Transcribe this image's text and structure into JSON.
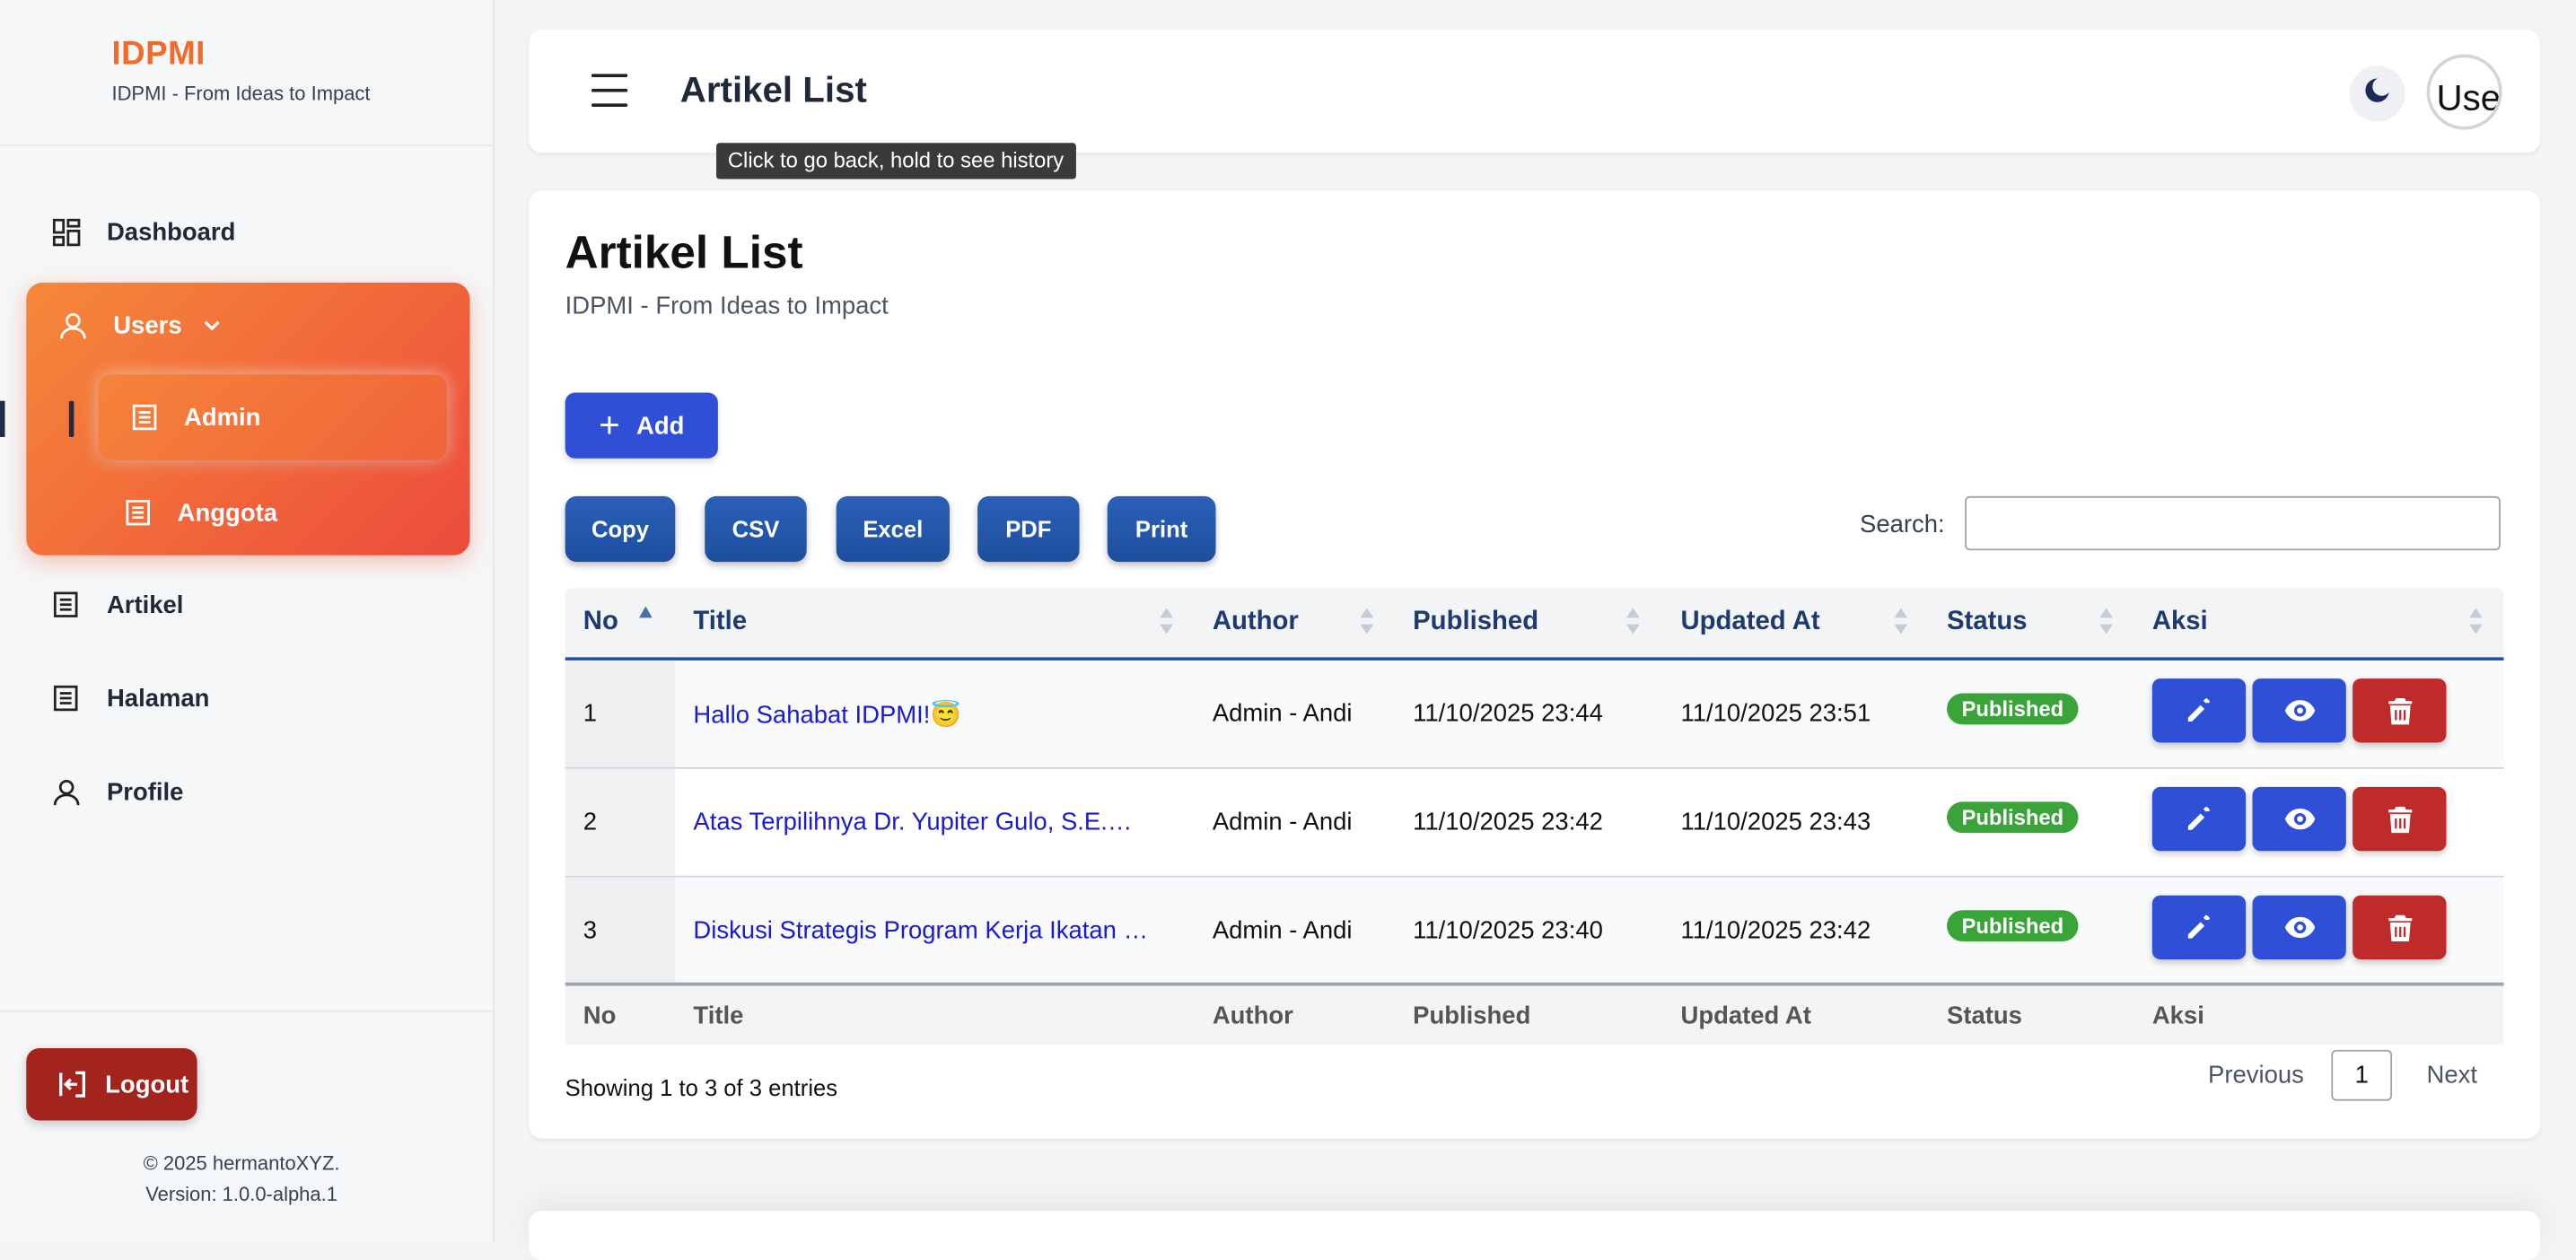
{
  "brand": {
    "title": "IDPMI",
    "subtitle": "IDPMI - From Ideas to Impact"
  },
  "sidebar": {
    "items": [
      {
        "label": "Dashboard",
        "icon": "dashboard-icon"
      },
      {
        "label": "Users",
        "icon": "user-icon",
        "expanded": true,
        "children": [
          {
            "label": "Admin",
            "active": true
          },
          {
            "label": "Anggota"
          }
        ]
      },
      {
        "label": "Artikel",
        "icon": "document-icon"
      },
      {
        "label": "Halaman",
        "icon": "document-icon"
      },
      {
        "label": "Profile",
        "icon": "user-icon"
      }
    ],
    "logout": "Logout",
    "copyright": "© 2025 hermantoXYZ.",
    "version": "Version: 1.0.0-alpha.1"
  },
  "topbar": {
    "title": "Artikel List",
    "tooltip": "Click to go back, hold to see history",
    "avatar_alt": "Use"
  },
  "page": {
    "title": "Artikel List",
    "subtitle": "IDPMI - From Ideas to Impact",
    "add_label": "Add",
    "export_buttons": [
      "Copy",
      "CSV",
      "Excel",
      "PDF",
      "Print"
    ],
    "search_label": "Search:",
    "search_value": ""
  },
  "table": {
    "columns": [
      "No",
      "Title",
      "Author",
      "Published",
      "Updated At",
      "Status",
      "Aksi"
    ],
    "rows": [
      {
        "no": "1",
        "title": "Hallo Sahabat IDPMI!😇",
        "author": "Admin - Andi",
        "published": "11/10/2025 23:44",
        "updated": "11/10/2025 23:51",
        "status": "Published"
      },
      {
        "no": "2",
        "title": "Atas Terpilihnya Dr. Yupiter Gulo, S.E.…",
        "author": "Admin - Andi",
        "published": "11/10/2025 23:42",
        "updated": "11/10/2025 23:43",
        "status": "Published"
      },
      {
        "no": "3",
        "title": "Diskusi Strategis Program Kerja Ikatan …",
        "author": "Admin - Andi",
        "published": "11/10/2025 23:40",
        "updated": "11/10/2025 23:42",
        "status": "Published"
      }
    ],
    "info": "Showing 1 to 3 of 3 entries",
    "pagination": {
      "previous": "Previous",
      "current": "1",
      "next": "Next"
    }
  },
  "colors": {
    "brand": "#f36b2b",
    "primary": "#2e4fd6",
    "export": "#1f55a8",
    "danger": "#bf2a2a",
    "status_published": "#3aa33a"
  }
}
